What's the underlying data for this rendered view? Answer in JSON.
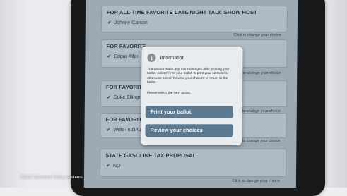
{
  "contests": [
    {
      "title": "FOR ALL-TIME FAVORITE LATE NIGHT TALK SHOW HOST",
      "choice": "Johnny Carson",
      "change_label": "Click to change your choice"
    },
    {
      "title": "FOR FAVORITE",
      "choice": "Edgar Allen",
      "change_label": "Click to change your choice"
    },
    {
      "title": "FOR FAVORITE",
      "choice": "Duke Ellingt",
      "change_label": "Click to change your choice"
    },
    {
      "title": "FOR FAVORITE",
      "choice": "Write-in DAV",
      "change_label": "Click to change your choice"
    },
    {
      "title": "STATE GASOLINE TAX PROPOSAL",
      "choice": "NO",
      "change_label": "Click to change your choice"
    }
  ],
  "modal": {
    "icon": "i",
    "title": "Information",
    "message": "You cannot make any more changes after printing your ballot. Select 'Print your ballot' to print your selections, otherwise select 'Review your choices' to return to the ballot.",
    "prompt": "Please select the next action.",
    "print_button": "Print your ballot",
    "review_button": "Review your choices"
  },
  "copyright": "©2017 Dominion Voting Systems"
}
